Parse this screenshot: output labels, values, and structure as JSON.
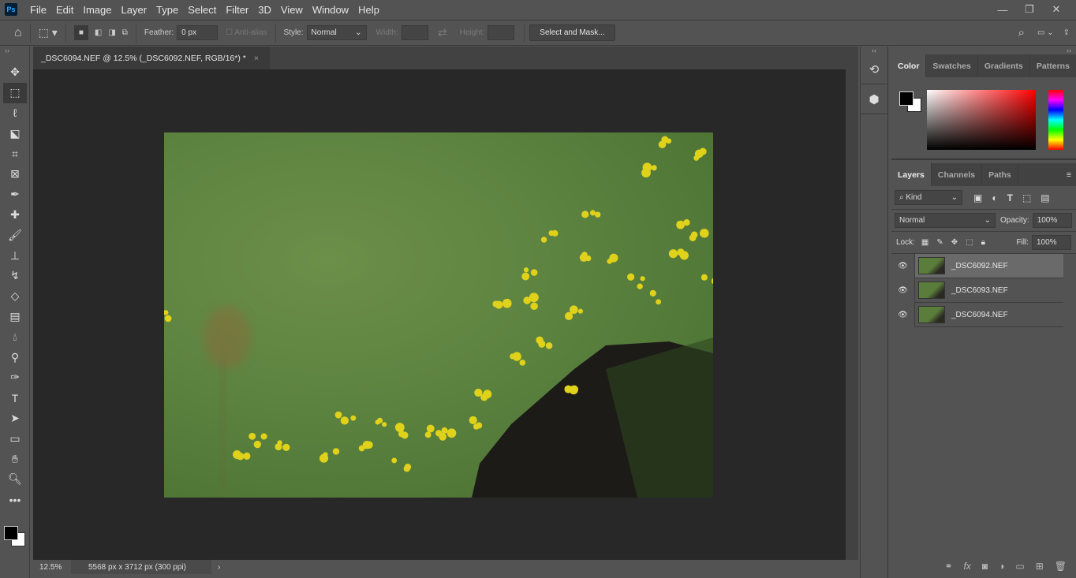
{
  "app": {
    "logo": "Ps"
  },
  "menu": [
    "File",
    "Edit",
    "Image",
    "Layer",
    "Type",
    "Select",
    "Filter",
    "3D",
    "View",
    "Window",
    "Help"
  ],
  "window_controls": {
    "minimize": "—",
    "restore": "❐",
    "close": "✕"
  },
  "options": {
    "feather_label": "Feather:",
    "feather_value": "0 px",
    "antialias_label": "Anti-alias",
    "style_label": "Style:",
    "style_value": "Normal",
    "width_label": "Width:",
    "height_label": "Height:",
    "select_mask": "Select and Mask..."
  },
  "document_tab": {
    "title": "_DSC6094.NEF @ 12.5% (_DSC6092.NEF, RGB/16*) *",
    "close": "×"
  },
  "status": {
    "zoom": "12.5%",
    "info": "5568 px x 3712 px (300 ppi)",
    "arrow": "›"
  },
  "color_panel": {
    "tabs": [
      "Color",
      "Swatches",
      "Gradients",
      "Patterns"
    ],
    "foreground": "#000000",
    "background": "#ffffff"
  },
  "layers_panel": {
    "tabs": [
      "Layers",
      "Channels",
      "Paths"
    ],
    "filter": "Kind",
    "blend": "Normal",
    "opacity_label": "Opacity:",
    "opacity": "100%",
    "lock_label": "Lock:",
    "fill_label": "Fill:",
    "fill": "100%",
    "layers": [
      {
        "name": "_DSC6092.NEF",
        "selected": true
      },
      {
        "name": "_DSC6093.NEF",
        "selected": false
      },
      {
        "name": "_DSC6094.NEF",
        "selected": false
      }
    ]
  },
  "tools": [
    "move-icon",
    "marquee-icon",
    "lasso-icon",
    "object-select-icon",
    "crop-icon",
    "frame-icon",
    "eyedropper-icon",
    "healing-icon",
    "brush-icon",
    "stamp-icon",
    "history-brush-icon",
    "eraser-icon",
    "gradient-icon",
    "blur-icon",
    "dodge-icon",
    "pen-icon",
    "type-icon",
    "path-select-icon",
    "rectangle-icon",
    "hand-icon",
    "zoom-icon",
    "more-icon"
  ]
}
